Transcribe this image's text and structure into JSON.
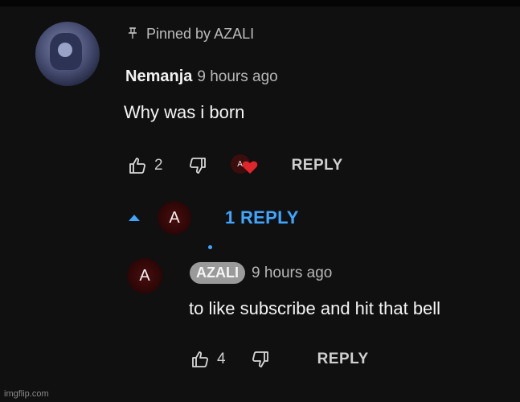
{
  "comment": {
    "pinned_label": "Pinned by AZALI",
    "author": "Nemanja",
    "time": "9 hours ago",
    "text": "Why was i born",
    "likes": "2",
    "reply_label": "REPLY",
    "heart_avatar_letter": "A"
  },
  "thread": {
    "avatar_letter": "A",
    "replies_label": "1 REPLY"
  },
  "reply": {
    "avatar_letter": "A",
    "author": "AZALI",
    "time": "9 hours ago",
    "text": "to like subscribe and hit that bell",
    "likes": "4",
    "reply_label": "REPLY"
  },
  "watermark": "imgflip.com",
  "colors": {
    "background": "#101010",
    "link_blue": "#3ea6ff",
    "heart_red": "#e0262b",
    "badge_gray": "#9a9a9a"
  },
  "icons": {
    "pin": "pin-icon",
    "like": "thumbs-up-icon",
    "dislike": "thumbs-down-icon",
    "heart": "heart-icon",
    "collapse": "caret-up-icon"
  }
}
